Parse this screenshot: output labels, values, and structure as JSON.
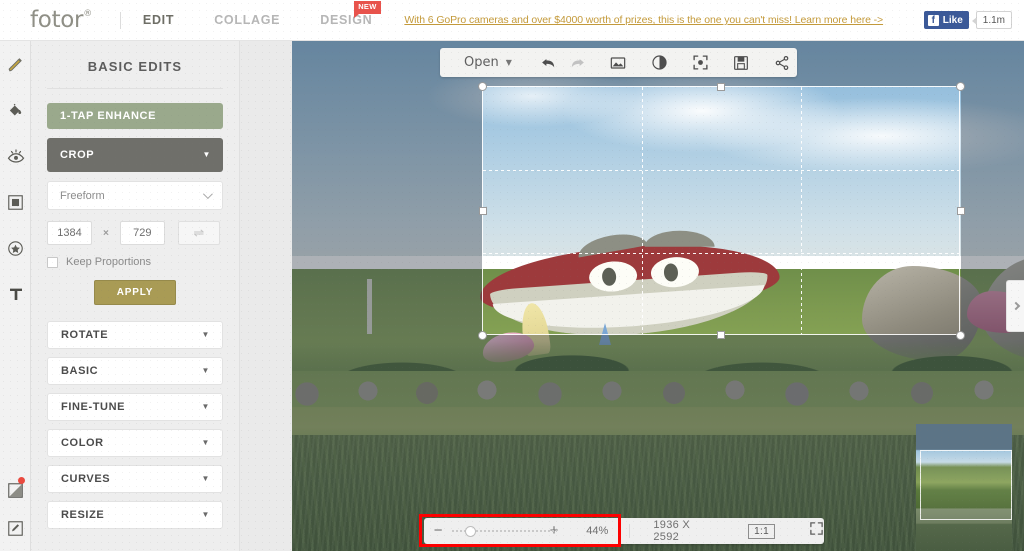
{
  "topbar": {
    "logo": "fotor",
    "logo_sup": "®",
    "nav": [
      {
        "label": "EDIT",
        "active": true,
        "badge": null
      },
      {
        "label": "COLLAGE",
        "active": false,
        "badge": null
      },
      {
        "label": "DESIGN",
        "active": false,
        "badge": "NEW"
      }
    ],
    "promo_text": "With 6 GoPro cameras and over $4000 worth of prizes, this is the one you can't miss! Learn more here ->",
    "facebook": {
      "f": "f",
      "like_label": "Like",
      "count": "1.1m"
    }
  },
  "rail": {
    "items": [
      {
        "name": "pencil-icon",
        "title": "Basic Edits"
      },
      {
        "name": "paint-bucket-icon",
        "title": "Effects"
      },
      {
        "name": "eye-icon",
        "title": "Beauty"
      },
      {
        "name": "frame-icon",
        "title": "Frames"
      },
      {
        "name": "star-badge-icon",
        "title": "Stickers"
      },
      {
        "name": "text-icon",
        "title": "Text"
      }
    ],
    "bottom": [
      {
        "name": "compare-icon",
        "badge": true
      },
      {
        "name": "edit-square-icon",
        "badge": false
      }
    ]
  },
  "panel": {
    "title": "BASIC EDITS",
    "enhance_label": "1-TAP ENHANCE",
    "crop_label": "CROP",
    "ratio_value": "Freeform",
    "width_value": "1384",
    "height_value": "729",
    "times_symbol": "×",
    "swap_icon": "⇌",
    "keep_proportions_label": "Keep Proportions",
    "apply_label": "APPLY",
    "sections": [
      "ROTATE",
      "BASIC",
      "FINE-TUNE",
      "COLOR",
      "CURVES",
      "RESIZE"
    ]
  },
  "toolbar": {
    "open_label": "Open",
    "icons": [
      {
        "name": "undo-icon",
        "dim": false
      },
      {
        "name": "redo-icon",
        "dim": true
      },
      {
        "name": "image-icon",
        "dim": false
      },
      {
        "name": "contrast-icon",
        "dim": false
      },
      {
        "name": "fit-screen-icon",
        "dim": false
      },
      {
        "name": "save-icon",
        "dim": false
      },
      {
        "name": "share-icon",
        "dim": false
      }
    ]
  },
  "zoombar": {
    "minus": "−",
    "plus": "+",
    "zoom_percent": "44%",
    "dimensions": "1936 X 2592",
    "ratio_label": "1:1",
    "expand_icon": "fullscreen-icon",
    "highlight_color": "#fd0000"
  },
  "navigator": {
    "label": "navigator-thumbnail"
  },
  "expander": {
    "icon": "chevron-right-icon"
  }
}
